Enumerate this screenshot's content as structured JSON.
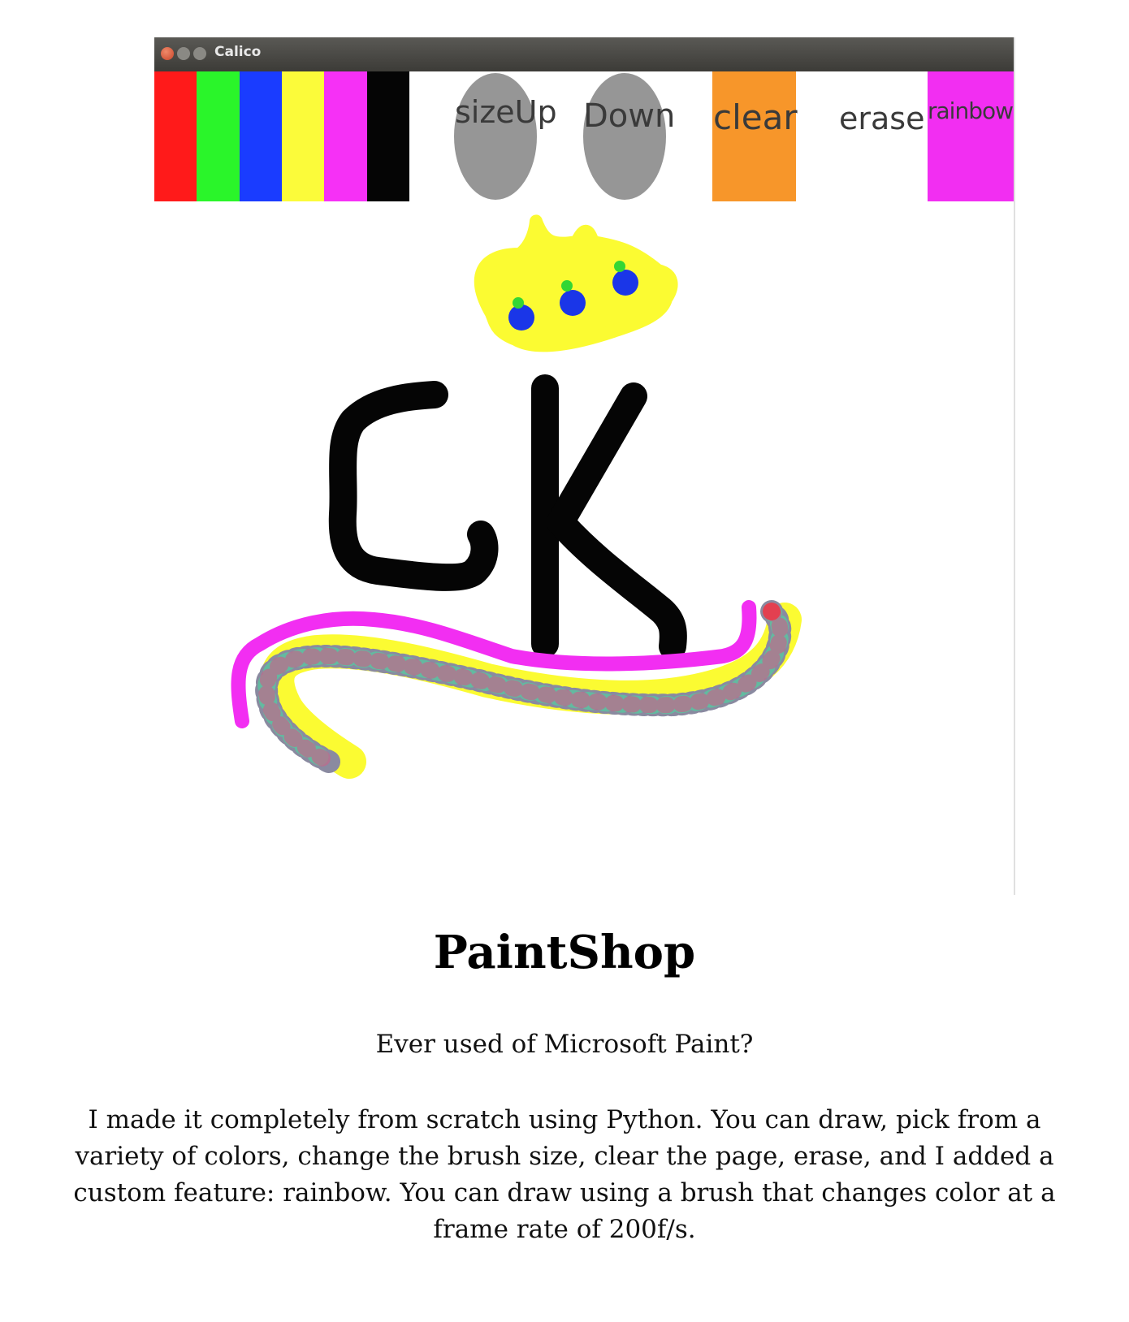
{
  "window": {
    "title": "Calico"
  },
  "toolbar": {
    "swatches": [
      {
        "name": "red",
        "color": "#ff1a1a"
      },
      {
        "name": "green",
        "color": "#2af52a"
      },
      {
        "name": "blue",
        "color": "#1a3cff"
      },
      {
        "name": "yellow",
        "color": "#fbfb3a"
      },
      {
        "name": "magenta",
        "color": "#f630f6"
      },
      {
        "name": "black",
        "color": "#050505"
      }
    ],
    "size_up_label": "sizeUp",
    "size_down_label": "Down",
    "clear_label": "clear",
    "erase_label": "erase",
    "rainbow_label": "rainbow"
  },
  "drawing": {
    "initials": "CK"
  },
  "content": {
    "title": "PaintShop",
    "question": "Ever used of Microsoft Paint?",
    "description": "I made it completely from scratch using Python. You can draw, pick from a variety of colors, change the brush size, clear the page, erase, and I added a custom feature: rainbow. You can draw using a brush that changes color at a frame rate of 200f/s."
  }
}
